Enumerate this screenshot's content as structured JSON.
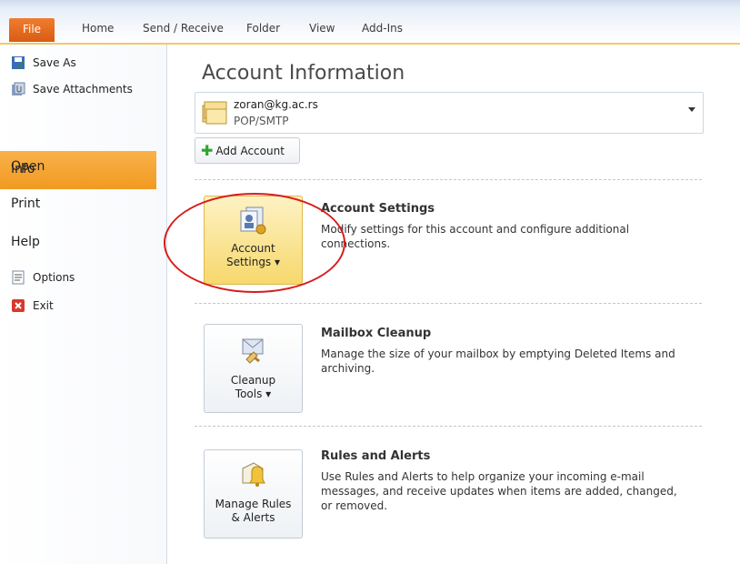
{
  "ribbon": {
    "tabs": [
      "File",
      "Home",
      "Send / Receive",
      "Folder",
      "View",
      "Add-Ins"
    ]
  },
  "nav": {
    "save_as": "Save As",
    "save_attachments": "Save Attachments",
    "info": "Info",
    "open": "Open",
    "print": "Print",
    "help": "Help",
    "options": "Options",
    "exit": "Exit"
  },
  "main": {
    "title": "Account Information",
    "account": {
      "email": "zoran@kg.ac.rs",
      "type": "POP/SMTP"
    },
    "add_account": "Add Account",
    "sections": [
      {
        "button_label_1": "Account",
        "button_label_2": "Settings ▾",
        "title": "Account Settings",
        "description": "Modify settings for this account and configure additional connections.",
        "icon": "account-settings-icon"
      },
      {
        "button_label_1": "Cleanup",
        "button_label_2": "Tools ▾",
        "title": "Mailbox Cleanup",
        "description": "Manage the size of your mailbox by emptying Deleted Items and archiving.",
        "icon": "cleanup-tools-icon"
      },
      {
        "button_label_1": "Manage Rules",
        "button_label_2": "& Alerts",
        "title": "Rules and Alerts",
        "description": "Use Rules and Alerts to help organize your incoming e-mail messages, and receive updates when items are added, changed, or removed.",
        "icon": "rules-alerts-icon"
      }
    ]
  },
  "colors": {
    "file_tab": "#e56b1f",
    "info_highlight": "#f5a833",
    "annotation_circle": "#d81c1c"
  }
}
